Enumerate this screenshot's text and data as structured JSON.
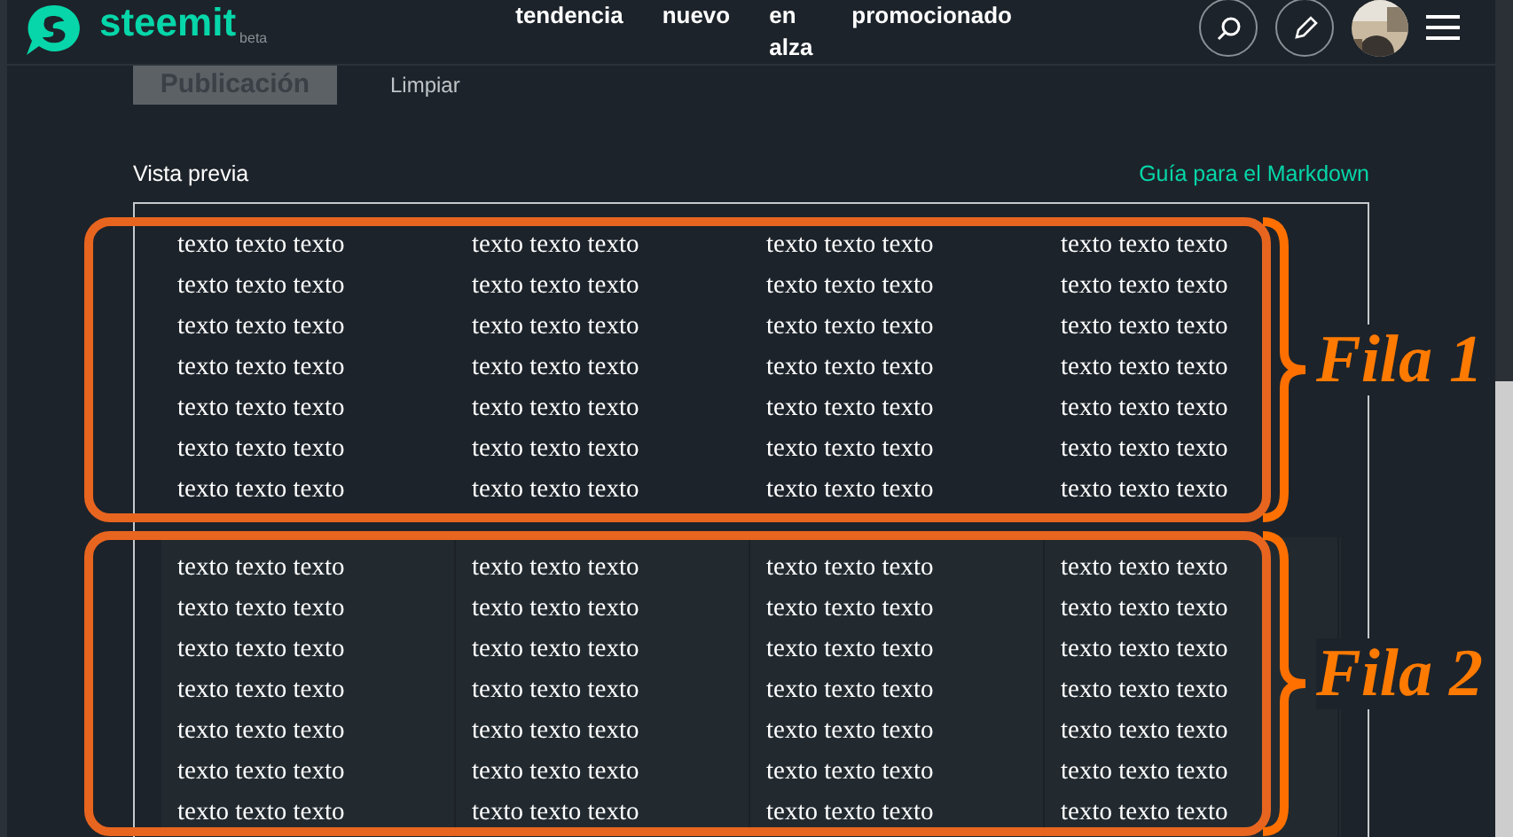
{
  "header": {
    "logo": "steemit",
    "logo_badge": "beta",
    "nav": [
      {
        "label": "tendencia"
      },
      {
        "label": "nuevo"
      },
      {
        "label": "en alza"
      },
      {
        "label": "promocionado"
      }
    ]
  },
  "editor": {
    "buttons": [
      {
        "label": "Publicación",
        "kind": "primary"
      },
      {
        "label": "Limpiar",
        "kind": "link"
      }
    ]
  },
  "preview": {
    "title": "Vista previa",
    "guide_link": "Guía para el Markdown",
    "rows": [
      {
        "striped": false,
        "cells": [
          [
            "texto texto texto",
            "texto texto texto",
            "texto texto texto",
            "texto texto texto",
            "texto texto texto",
            "texto texto texto",
            "texto texto texto"
          ],
          [
            "texto texto texto",
            "texto texto texto",
            "texto texto texto",
            "texto texto texto",
            "texto texto texto",
            "texto texto texto",
            "texto texto texto"
          ],
          [
            "texto texto texto",
            "texto texto texto",
            "texto texto texto",
            "texto texto texto",
            "texto texto texto",
            "texto texto texto",
            "texto texto texto"
          ],
          [
            "texto texto texto",
            "texto texto texto",
            "texto texto texto",
            "texto texto texto",
            "texto texto texto",
            "texto texto texto",
            "texto texto texto"
          ]
        ]
      },
      {
        "striped": true,
        "cells": [
          [
            "texto texto texto",
            "texto texto texto",
            "texto texto texto",
            "texto texto texto",
            "texto texto texto",
            "texto texto texto",
            "texto texto texto"
          ],
          [
            "texto texto texto",
            "texto texto texto",
            "texto texto texto",
            "texto texto texto",
            "texto texto texto",
            "texto texto texto",
            "texto texto texto"
          ],
          [
            "texto texto texto",
            "texto texto texto",
            "texto texto texto",
            "texto texto texto",
            "texto texto texto",
            "texto texto texto",
            "texto texto texto"
          ],
          [
            "texto texto texto",
            "texto texto texto",
            "texto texto texto",
            "texto texto texto",
            "texto texto texto",
            "texto texto texto",
            "texto texto texto"
          ]
        ]
      }
    ]
  },
  "annotations": [
    {
      "label": "Fila 1"
    },
    {
      "label": "Fila 2"
    }
  ]
}
